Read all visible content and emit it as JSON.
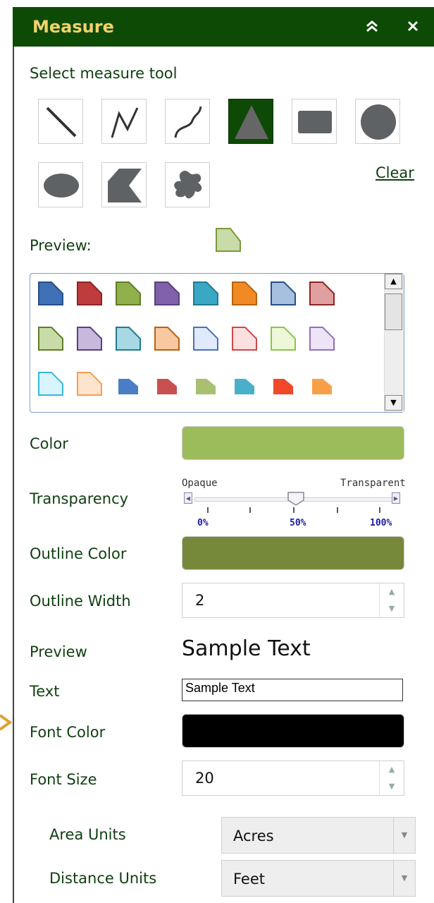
{
  "window": {
    "title": "Measure",
    "collapse_icon": "double-chevron-up-icon",
    "close_icon": "close-icon",
    "collapse_glyph": "»",
    "close_glyph": "×"
  },
  "tools": {
    "heading": "Select measure tool",
    "items": [
      {
        "name": "line-tool-icon"
      },
      {
        "name": "polyline-tool-icon"
      },
      {
        "name": "freehand-line-tool-icon"
      },
      {
        "name": "triangle-tool-icon",
        "selected": true
      },
      {
        "name": "rectangle-tool-icon"
      },
      {
        "name": "circle-tool-icon"
      },
      {
        "name": "ellipse-tool-icon"
      },
      {
        "name": "polygon-tool-icon"
      },
      {
        "name": "freehand-polygon-tool-icon"
      }
    ],
    "clear_label": "Clear"
  },
  "preview": {
    "label": "Preview:",
    "fill": "#c8dba8",
    "stroke": "#7a9a3a"
  },
  "palette": {
    "symbols": [
      {
        "fill": "#3f6fb4",
        "stroke": "#27508a"
      },
      {
        "fill": "#c03c3c",
        "stroke": "#8f2424"
      },
      {
        "fill": "#8fb04a",
        "stroke": "#5e7e24"
      },
      {
        "fill": "#8060a8",
        "stroke": "#5a3e80"
      },
      {
        "fill": "#3aa8c4",
        "stroke": "#207a92"
      },
      {
        "fill": "#f28a24",
        "stroke": "#b8620e"
      },
      {
        "fill": "#a8c0e0",
        "stroke": "#27508a"
      },
      {
        "fill": "#e0a0a0",
        "stroke": "#8f2424"
      },
      {
        "fill": "#c8dba8",
        "stroke": "#5e7e24"
      },
      {
        "fill": "#c8b8dc",
        "stroke": "#5a3e80"
      },
      {
        "fill": "#a8d8e4",
        "stroke": "#207a92"
      },
      {
        "fill": "#f8c8a0",
        "stroke": "#b8620e"
      },
      {
        "fill": "#e0eafc",
        "stroke": "#4a70c0"
      },
      {
        "fill": "#fce0e0",
        "stroke": "#d04848"
      },
      {
        "fill": "#ecf8d8",
        "stroke": "#8cc44a"
      },
      {
        "fill": "#eee4f8",
        "stroke": "#9070c0"
      },
      {
        "fill": "#d8f4fc",
        "stroke": "#38b8d8"
      },
      {
        "fill": "#fde4cc",
        "stroke": "#f8a050"
      },
      {
        "fill": "#4a7ec4",
        "stroke": "#4a7ec4",
        "small": true
      },
      {
        "fill": "#c85050",
        "stroke": "#c85050",
        "small": true
      },
      {
        "fill": "#a8c070",
        "stroke": "#a8c070",
        "small": true
      },
      {
        "fill": "#48b0c8",
        "stroke": "#48b0c8",
        "small": true
      },
      {
        "fill": "#f04828",
        "stroke": "#f04828",
        "small": true
      },
      {
        "fill": "#f8a048",
        "stroke": "#f8a048",
        "small": true
      }
    ]
  },
  "color": {
    "label": "Color",
    "value": "#9cbc5c"
  },
  "transparency": {
    "label": "Transparency",
    "left_label": "Opaque",
    "right_label": "Transparent",
    "ticks": [
      "0%",
      "50%",
      "100%"
    ],
    "value_percent": 50
  },
  "outline_color": {
    "label": "Outline Color",
    "value": "#76883a"
  },
  "outline_width": {
    "label": "Outline Width",
    "value": "2"
  },
  "text_preview": {
    "label": "Preview",
    "sample": "Sample Text"
  },
  "text": {
    "label": "Text",
    "value": "Sample Text"
  },
  "font_color": {
    "label": "Font Color",
    "value": "#000000"
  },
  "font_size": {
    "label": "Font Size",
    "value": "20"
  },
  "area_units": {
    "label": "Area Units",
    "value": "Acres"
  },
  "distance_units": {
    "label": "Distance Units",
    "value": "Feet"
  }
}
